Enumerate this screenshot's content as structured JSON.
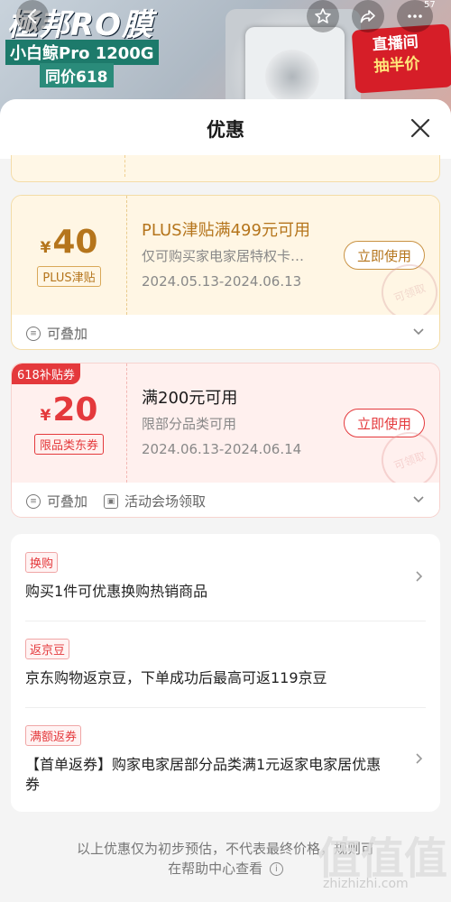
{
  "banner": {
    "title": "極邦RO膜",
    "subtitle": "小白鲸Pro 1200G",
    "price_label": "同价618",
    "live_line1": "直播间",
    "live_line2": "抽半价",
    "badge_count": "57"
  },
  "sheet": {
    "title": "优惠",
    "close_label": "close"
  },
  "coupons": [
    {
      "currency": "¥",
      "amount": "40",
      "type_tag": "PLUS津贴",
      "title": "PLUS津贴满499元可用",
      "desc": "仅可购买家电家居特权卡…",
      "date": "2024.05.13-2024.06.13",
      "button": "立即使用",
      "stamp": "可领取",
      "foot_items": [
        "可叠加"
      ]
    },
    {
      "corner_tag": "618补贴券",
      "currency": "¥",
      "amount": "20",
      "type_tag": "限品类东券",
      "title": "满200元可用",
      "desc": "限部分品类可用",
      "date": "2024.06.13-2024.06.14",
      "button": "立即使用",
      "stamp": "可领取",
      "foot_items": [
        "可叠加",
        "活动会场领取"
      ]
    }
  ],
  "promos": [
    {
      "tag": "换购",
      "text": "购买1件可优惠换购热销商品",
      "has_arrow": true
    },
    {
      "tag": "返京豆",
      "text": "京东购物返京豆，下单成功后最高可返119京豆",
      "has_arrow": false
    },
    {
      "tag": "满额返券",
      "text": "【首单返券】购家电家居部分品类满1元返家电家居优惠券",
      "has_arrow": true
    }
  ],
  "footnote": {
    "line1": "以上优惠仅为初步预估，不代表最终价格，规则可",
    "line2": "在帮助中心查看"
  },
  "watermark": {
    "text": "值值值",
    "url": "zhizhizhi.com"
  },
  "colors": {
    "accent_red": "#e4393c",
    "plus_gold": "#b5751c"
  }
}
